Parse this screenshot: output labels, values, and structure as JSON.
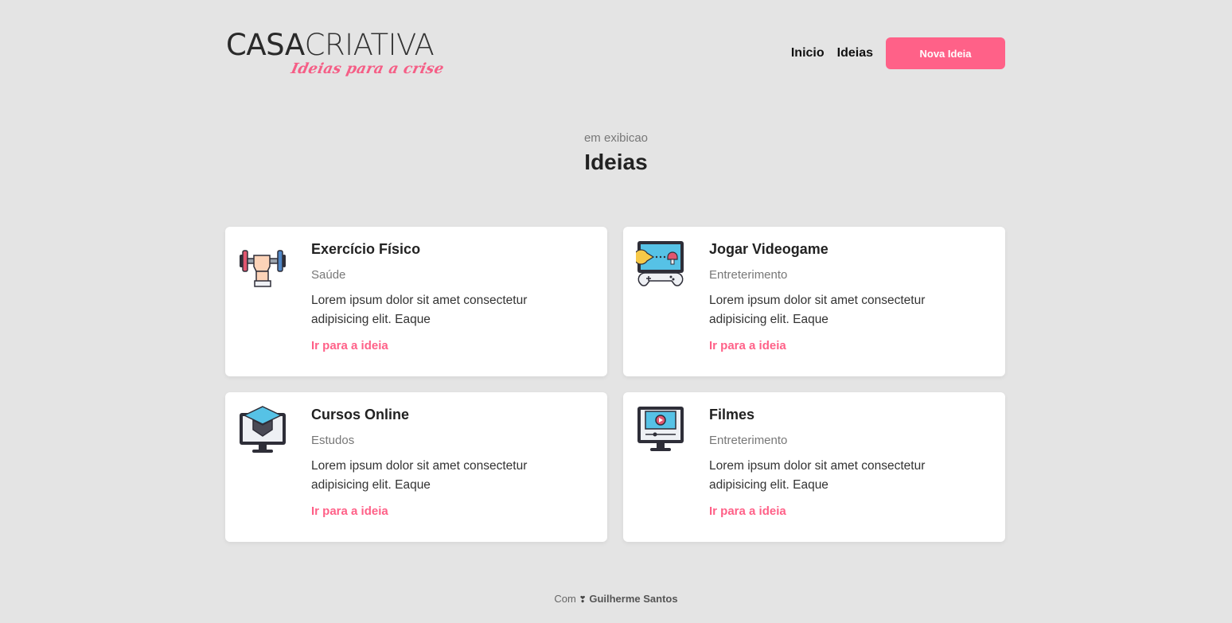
{
  "header": {
    "logo": {
      "part1": "CASA",
      "part2": "CRIATIVA",
      "tagline": "Ideias para a crise"
    },
    "nav": {
      "inicio": "Inicio",
      "ideias": "Ideias",
      "nova_ideia": "Nova Ideia"
    }
  },
  "main": {
    "subtitle": "em exibicao",
    "title": "Ideias"
  },
  "cards": [
    {
      "icon": "dumbbell-icon",
      "title": "Exercício Físico",
      "category": "Saúde",
      "description": "Lorem ipsum dolor sit amet consectetur adipisicing elit. Eaque",
      "link": "Ir para a ideia"
    },
    {
      "icon": "videogame-icon",
      "title": "Jogar Videogame",
      "category": "Entreterimento",
      "description": "Lorem ipsum dolor sit amet consectetur adipisicing elit. Eaque",
      "link": "Ir para a ideia"
    },
    {
      "icon": "online-course-icon",
      "title": "Cursos Online",
      "category": "Estudos",
      "description": "Lorem ipsum dolor sit amet consectetur adipisicing elit. Eaque",
      "link": "Ir para a ideia"
    },
    {
      "icon": "movie-player-icon",
      "title": "Filmes",
      "category": "Entreterimento",
      "description": "Lorem ipsum dolor sit amet consectetur adipisicing elit. Eaque",
      "link": "Ir para a ideia"
    }
  ],
  "footer": {
    "prefix": "Com",
    "heart": "❣",
    "author": "Guilherme Santos"
  },
  "colors": {
    "accent": "#ff6188",
    "background": "#e4e4e4",
    "card": "#ffffff"
  }
}
